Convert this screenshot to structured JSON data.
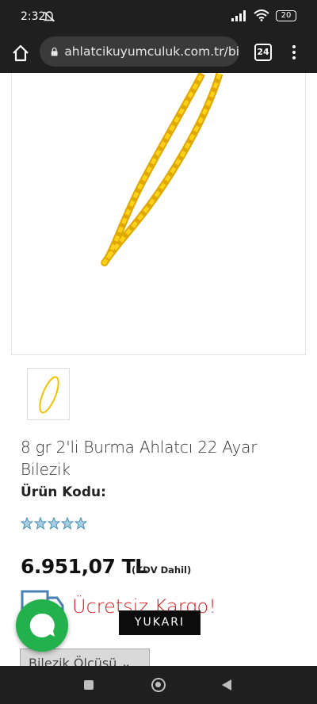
{
  "status": {
    "time": "2:32",
    "battery": "20"
  },
  "browser": {
    "url": "ahlatcikuyumculuk.com.tr/bi",
    "tab_count": "24"
  },
  "product": {
    "title": "8 gr 2'li Burma Ahlatcı 22 Ayar Bilezik",
    "code_label": "Ürün Kodu:",
    "rating": 5,
    "price": "6.951,07 TL",
    "vat_note": "(KDV Dahil)",
    "shipping": "Ücretsiz Kargo!",
    "size_select": "Bilezik Ölçüsü ⌄"
  },
  "colors": {
    "gold": "#f2c200",
    "shipping_red": "#e0191d",
    "chat_green": "#23b14d",
    "chrome_dark": "#1f1f1f"
  },
  "scroll_top_button": "YUKARI"
}
